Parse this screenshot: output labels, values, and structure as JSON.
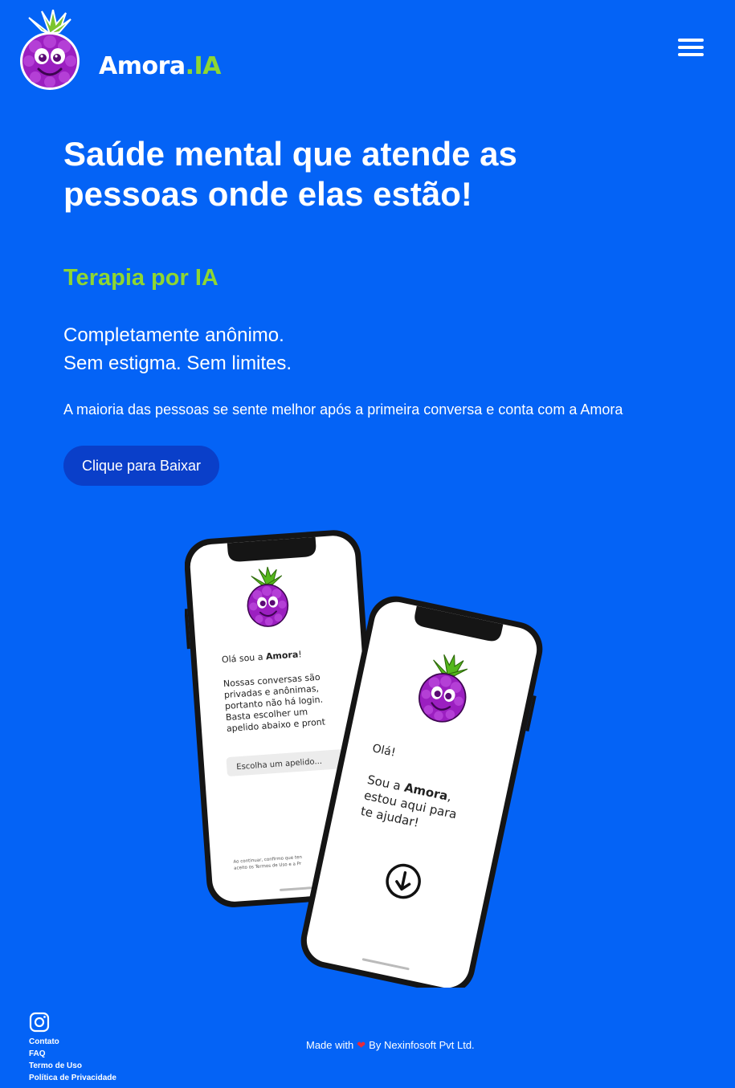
{
  "header": {
    "logo_text_main": "Amora",
    "logo_text_accent": ".IA",
    "menu_icon": "hamburger-menu-icon"
  },
  "hero": {
    "headline_line1": "Saúde mental que atende as",
    "headline_line2": "pessoas onde elas estão!",
    "subtitle": "Terapia por IA",
    "tagline_line1": "Completamente anônimo.",
    "tagline_line2": "Sem estigma. Sem limites.",
    "description": "A maioria das pessoas se sente melhor após a primeira conversa e conta com a Amora",
    "cta_label": "Clique para Baixar"
  },
  "phone_left": {
    "greeting_prefix": "Olá sou a ",
    "greeting_name": "Amora",
    "greeting_suffix": "!",
    "text_lines": [
      "Nossas conversas são",
      "privadas e anônimas,",
      "portanto não há login.",
      "Basta escolher um",
      "apelido abaixo e pront"
    ],
    "nickname_placeholder": "Escolha um apelido...",
    "terms_line1": "Ao continuar, confirmo que ten",
    "terms_line2": "aceito os Termos de Uso e a Pr"
  },
  "phone_right": {
    "hello": "Olá!",
    "line1_prefix": "Sou a ",
    "line1_name": "Amora",
    "line1_suffix": ",",
    "line2": "estou aqui para",
    "line3": "te ajudar!"
  },
  "footer": {
    "instagram_icon": "instagram-icon",
    "links": [
      "Contato",
      "FAQ",
      "Termo de Uso",
      "Política de Privacidade"
    ],
    "made_with_prefix": "Made with",
    "made_with_suffix": "By Nexinfosoft Pvt Ltd."
  },
  "colors": {
    "background": "#0463f6",
    "accent_green": "#8ed632",
    "button": "#0a3fc9",
    "berry": "#9b1fc0"
  }
}
